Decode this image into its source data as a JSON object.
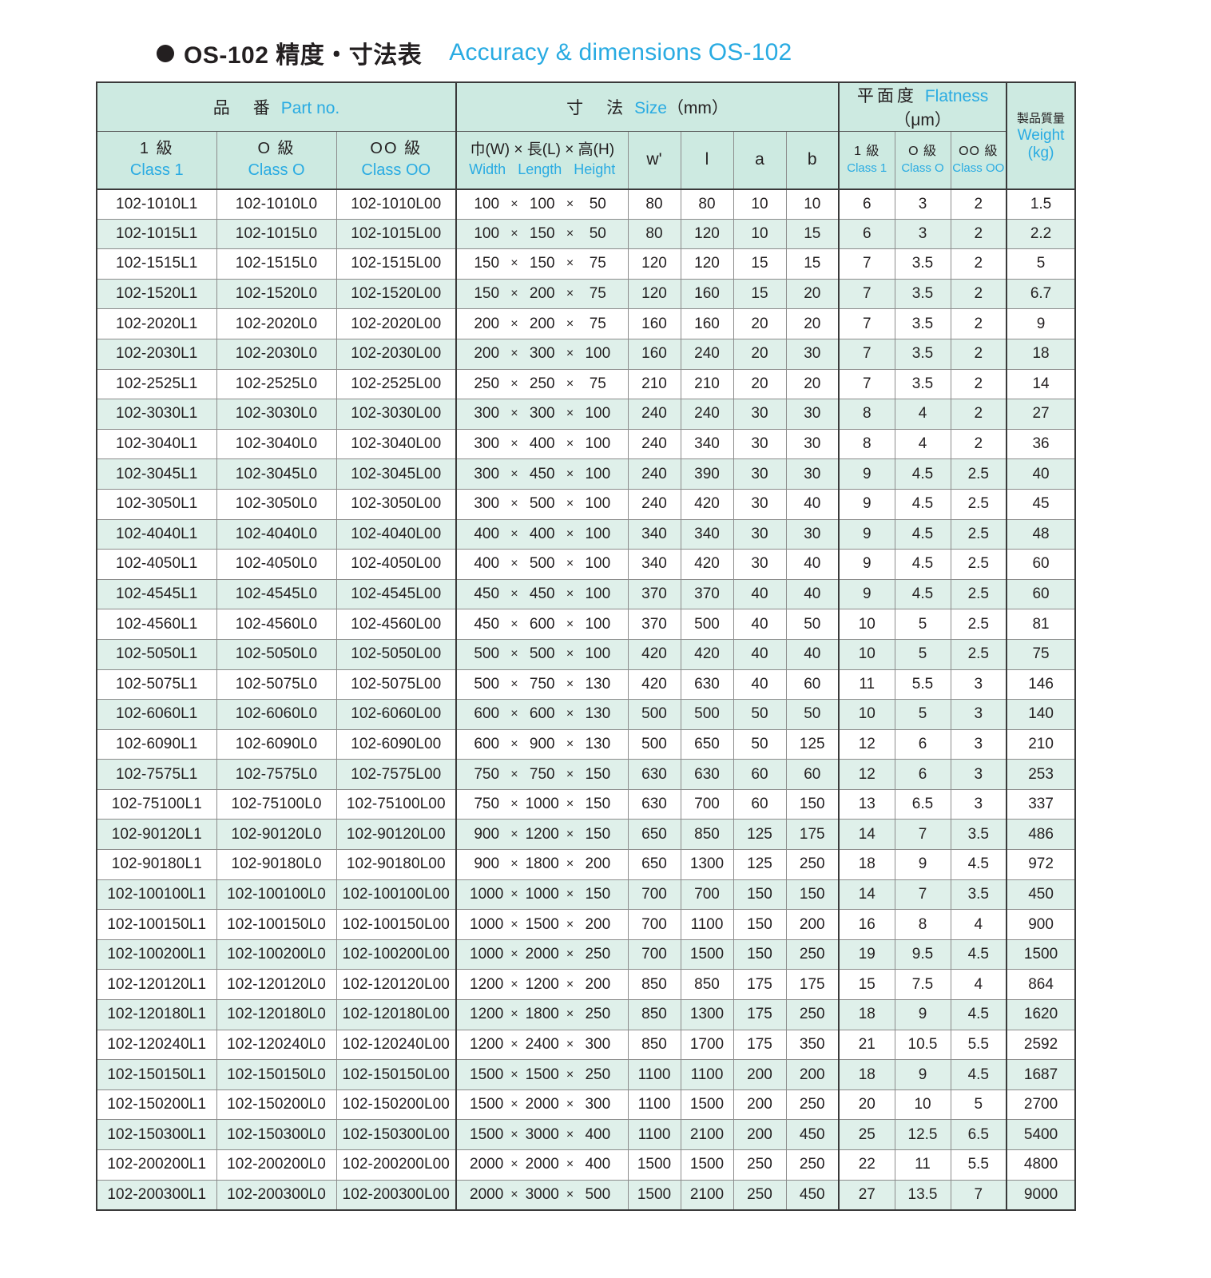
{
  "title": {
    "bullet": "bullet-icon",
    "jp": "OS-102 精度・寸法表",
    "en": "Accuracy & dimensions OS-102"
  },
  "colors": {
    "accent": "#29abe2",
    "header_bg": "#cdeae1",
    "row_alt_bg": "#dff0ea",
    "text": "#231f20",
    "border": "#3a3a3a"
  },
  "header": {
    "group_partno": {
      "jp": "品　番",
      "en": "Part no."
    },
    "group_size": {
      "jp": "寸　法",
      "en": "Size",
      "unit": "（mm）"
    },
    "group_flatness": {
      "jp": "平面度",
      "en": "Flatness",
      "unit": "（μm）"
    },
    "group_weight": {
      "jp": "製品質量",
      "en": "Weight",
      "unit": "(kg)"
    },
    "partno_cols": [
      {
        "jp": "1 級",
        "en": "Class 1"
      },
      {
        "jp": "O 級",
        "en": "Class O"
      },
      {
        "jp": "OO 級",
        "en": "Class OO"
      }
    ],
    "size_wlh": {
      "jp_w": "巾(W)",
      "jp_x1": "×",
      "jp_l": "長(L)",
      "jp_x2": "×",
      "jp_h": "高(H)",
      "en_w": "Width",
      "en_l": "Length",
      "en_h": "Height"
    },
    "size_syms": [
      "w'",
      "l",
      "a",
      "b"
    ],
    "flatness_cols": [
      {
        "jp": "1 級",
        "en": "Class 1"
      },
      {
        "jp": "O 級",
        "en": "Class O"
      },
      {
        "jp": "OO 級",
        "en": "Class OO"
      }
    ]
  },
  "table_data": {
    "type": "table",
    "columns": [
      "Class 1",
      "Class O",
      "Class OO",
      "Width",
      "Length",
      "Height",
      "w'",
      "l",
      "a",
      "b",
      "Flatness Class 1",
      "Flatness Class O",
      "Flatness Class OO",
      "Weight (kg)"
    ],
    "rows": [
      [
        "102-1010L1",
        "102-1010L0",
        "102-1010L00",
        "100",
        "100",
        "50",
        "80",
        "80",
        "10",
        "10",
        "6",
        "3",
        "2",
        "1.5"
      ],
      [
        "102-1015L1",
        "102-1015L0",
        "102-1015L00",
        "100",
        "150",
        "50",
        "80",
        "120",
        "10",
        "15",
        "6",
        "3",
        "2",
        "2.2"
      ],
      [
        "102-1515L1",
        "102-1515L0",
        "102-1515L00",
        "150",
        "150",
        "75",
        "120",
        "120",
        "15",
        "15",
        "7",
        "3.5",
        "2",
        "5"
      ],
      [
        "102-1520L1",
        "102-1520L0",
        "102-1520L00",
        "150",
        "200",
        "75",
        "120",
        "160",
        "15",
        "20",
        "7",
        "3.5",
        "2",
        "6.7"
      ],
      [
        "102-2020L1",
        "102-2020L0",
        "102-2020L00",
        "200",
        "200",
        "75",
        "160",
        "160",
        "20",
        "20",
        "7",
        "3.5",
        "2",
        "9"
      ],
      [
        "102-2030L1",
        "102-2030L0",
        "102-2030L00",
        "200",
        "300",
        "100",
        "160",
        "240",
        "20",
        "30",
        "7",
        "3.5",
        "2",
        "18"
      ],
      [
        "102-2525L1",
        "102-2525L0",
        "102-2525L00",
        "250",
        "250",
        "75",
        "210",
        "210",
        "20",
        "20",
        "7",
        "3.5",
        "2",
        "14"
      ],
      [
        "102-3030L1",
        "102-3030L0",
        "102-3030L00",
        "300",
        "300",
        "100",
        "240",
        "240",
        "30",
        "30",
        "8",
        "4",
        "2",
        "27"
      ],
      [
        "102-3040L1",
        "102-3040L0",
        "102-3040L00",
        "300",
        "400",
        "100",
        "240",
        "340",
        "30",
        "30",
        "8",
        "4",
        "2",
        "36"
      ],
      [
        "102-3045L1",
        "102-3045L0",
        "102-3045L00",
        "300",
        "450",
        "100",
        "240",
        "390",
        "30",
        "30",
        "9",
        "4.5",
        "2.5",
        "40"
      ],
      [
        "102-3050L1",
        "102-3050L0",
        "102-3050L00",
        "300",
        "500",
        "100",
        "240",
        "420",
        "30",
        "40",
        "9",
        "4.5",
        "2.5",
        "45"
      ],
      [
        "102-4040L1",
        "102-4040L0",
        "102-4040L00",
        "400",
        "400",
        "100",
        "340",
        "340",
        "30",
        "30",
        "9",
        "4.5",
        "2.5",
        "48"
      ],
      [
        "102-4050L1",
        "102-4050L0",
        "102-4050L00",
        "400",
        "500",
        "100",
        "340",
        "420",
        "30",
        "40",
        "9",
        "4.5",
        "2.5",
        "60"
      ],
      [
        "102-4545L1",
        "102-4545L0",
        "102-4545L00",
        "450",
        "450",
        "100",
        "370",
        "370",
        "40",
        "40",
        "9",
        "4.5",
        "2.5",
        "60"
      ],
      [
        "102-4560L1",
        "102-4560L0",
        "102-4560L00",
        "450",
        "600",
        "100",
        "370",
        "500",
        "40",
        "50",
        "10",
        "5",
        "2.5",
        "81"
      ],
      [
        "102-5050L1",
        "102-5050L0",
        "102-5050L00",
        "500",
        "500",
        "100",
        "420",
        "420",
        "40",
        "40",
        "10",
        "5",
        "2.5",
        "75"
      ],
      [
        "102-5075L1",
        "102-5075L0",
        "102-5075L00",
        "500",
        "750",
        "130",
        "420",
        "630",
        "40",
        "60",
        "11",
        "5.5",
        "3",
        "146"
      ],
      [
        "102-6060L1",
        "102-6060L0",
        "102-6060L00",
        "600",
        "600",
        "130",
        "500",
        "500",
        "50",
        "50",
        "10",
        "5",
        "3",
        "140"
      ],
      [
        "102-6090L1",
        "102-6090L0",
        "102-6090L00",
        "600",
        "900",
        "130",
        "500",
        "650",
        "50",
        "125",
        "12",
        "6",
        "3",
        "210"
      ],
      [
        "102-7575L1",
        "102-7575L0",
        "102-7575L00",
        "750",
        "750",
        "150",
        "630",
        "630",
        "60",
        "60",
        "12",
        "6",
        "3",
        "253"
      ],
      [
        "102-75100L1",
        "102-75100L0",
        "102-75100L00",
        "750",
        "1000",
        "150",
        "630",
        "700",
        "60",
        "150",
        "13",
        "6.5",
        "3",
        "337"
      ],
      [
        "102-90120L1",
        "102-90120L0",
        "102-90120L00",
        "900",
        "1200",
        "150",
        "650",
        "850",
        "125",
        "175",
        "14",
        "7",
        "3.5",
        "486"
      ],
      [
        "102-90180L1",
        "102-90180L0",
        "102-90180L00",
        "900",
        "1800",
        "200",
        "650",
        "1300",
        "125",
        "250",
        "18",
        "9",
        "4.5",
        "972"
      ],
      [
        "102-100100L1",
        "102-100100L0",
        "102-100100L00",
        "1000",
        "1000",
        "150",
        "700",
        "700",
        "150",
        "150",
        "14",
        "7",
        "3.5",
        "450"
      ],
      [
        "102-100150L1",
        "102-100150L0",
        "102-100150L00",
        "1000",
        "1500",
        "200",
        "700",
        "1100",
        "150",
        "200",
        "16",
        "8",
        "4",
        "900"
      ],
      [
        "102-100200L1",
        "102-100200L0",
        "102-100200L00",
        "1000",
        "2000",
        "250",
        "700",
        "1500",
        "150",
        "250",
        "19",
        "9.5",
        "4.5",
        "1500"
      ],
      [
        "102-120120L1",
        "102-120120L0",
        "102-120120L00",
        "1200",
        "1200",
        "200",
        "850",
        "850",
        "175",
        "175",
        "15",
        "7.5",
        "4",
        "864"
      ],
      [
        "102-120180L1",
        "102-120180L0",
        "102-120180L00",
        "1200",
        "1800",
        "250",
        "850",
        "1300",
        "175",
        "250",
        "18",
        "9",
        "4.5",
        "1620"
      ],
      [
        "102-120240L1",
        "102-120240L0",
        "102-120240L00",
        "1200",
        "2400",
        "300",
        "850",
        "1700",
        "175",
        "350",
        "21",
        "10.5",
        "5.5",
        "2592"
      ],
      [
        "102-150150L1",
        "102-150150L0",
        "102-150150L00",
        "1500",
        "1500",
        "250",
        "1100",
        "1100",
        "200",
        "200",
        "18",
        "9",
        "4.5",
        "1687"
      ],
      [
        "102-150200L1",
        "102-150200L0",
        "102-150200L00",
        "1500",
        "2000",
        "300",
        "1100",
        "1500",
        "200",
        "250",
        "20",
        "10",
        "5",
        "2700"
      ],
      [
        "102-150300L1",
        "102-150300L0",
        "102-150300L00",
        "1500",
        "3000",
        "400",
        "1100",
        "2100",
        "200",
        "450",
        "25",
        "12.5",
        "6.5",
        "5400"
      ],
      [
        "102-200200L1",
        "102-200200L0",
        "102-200200L00",
        "2000",
        "2000",
        "400",
        "1500",
        "1500",
        "250",
        "250",
        "22",
        "11",
        "5.5",
        "4800"
      ],
      [
        "102-200300L1",
        "102-200300L0",
        "102-200300L00",
        "2000",
        "3000",
        "500",
        "1500",
        "2100",
        "250",
        "450",
        "27",
        "13.5",
        "7",
        "9000"
      ]
    ]
  }
}
